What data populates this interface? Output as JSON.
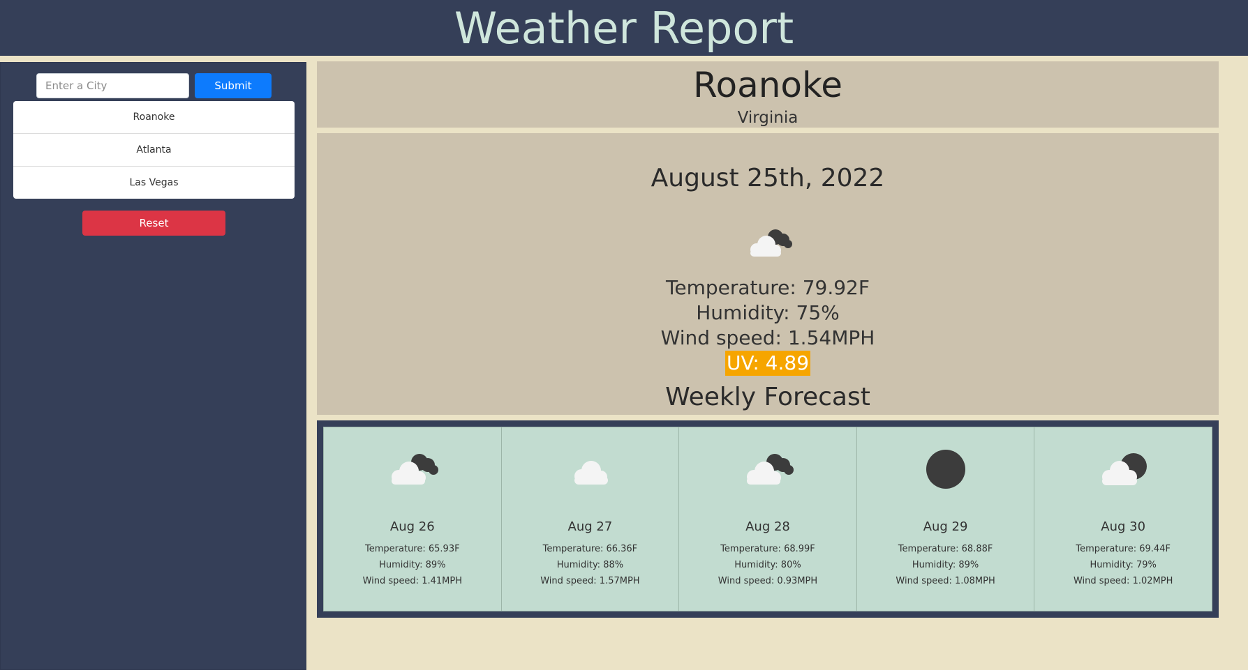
{
  "header": {
    "title": "Weather Report"
  },
  "sidebar": {
    "search": {
      "placeholder": "Enter a City",
      "value": ""
    },
    "submit_label": "Submit",
    "history": [
      {
        "label": "Roanoke"
      },
      {
        "label": "Atlanta"
      },
      {
        "label": "Las Vegas"
      }
    ],
    "reset_label": "Reset"
  },
  "current": {
    "city": "Roanoke",
    "state": "Virginia",
    "date": "August 25th, 2022",
    "icon": "partly-cloudy-night-icon",
    "temperature": "Temperature: 79.92F",
    "humidity": "Humidity: 75%",
    "wind": "Wind speed: 1.54MPH",
    "uv": "UV: 4.89",
    "uv_color": "#f6a500"
  },
  "forecast": {
    "title": "Weekly Forecast",
    "days": [
      {
        "date": "Aug 26",
        "icon": "broken-clouds-icon",
        "temperature": "Temperature: 65.93F",
        "humidity": "Humidity: 89%",
        "wind": "Wind speed: 1.41MPH"
      },
      {
        "date": "Aug 27",
        "icon": "cloud-icon",
        "temperature": "Temperature: 66.36F",
        "humidity": "Humidity: 88%",
        "wind": "Wind speed: 1.57MPH"
      },
      {
        "date": "Aug 28",
        "icon": "broken-clouds-icon",
        "temperature": "Temperature: 68.99F",
        "humidity": "Humidity: 80%",
        "wind": "Wind speed: 0.93MPH"
      },
      {
        "date": "Aug 29",
        "icon": "clear-night-icon",
        "temperature": "Temperature: 68.88F",
        "humidity": "Humidity: 89%",
        "wind": "Wind speed: 1.08MPH"
      },
      {
        "date": "Aug 30",
        "icon": "partly-cloudy-night-icon",
        "temperature": "Temperature: 69.44F",
        "humidity": "Humidity: 79%",
        "wind": "Wind speed: 1.02MPH"
      }
    ]
  },
  "colors": {
    "header_bg": "#353f58",
    "page_bg": "#ebe3c6",
    "panel_bg": "#ccc2ae",
    "card_bg": "#c2dcd0",
    "submit": "#0d7bfd",
    "reset": "#dc3545"
  }
}
